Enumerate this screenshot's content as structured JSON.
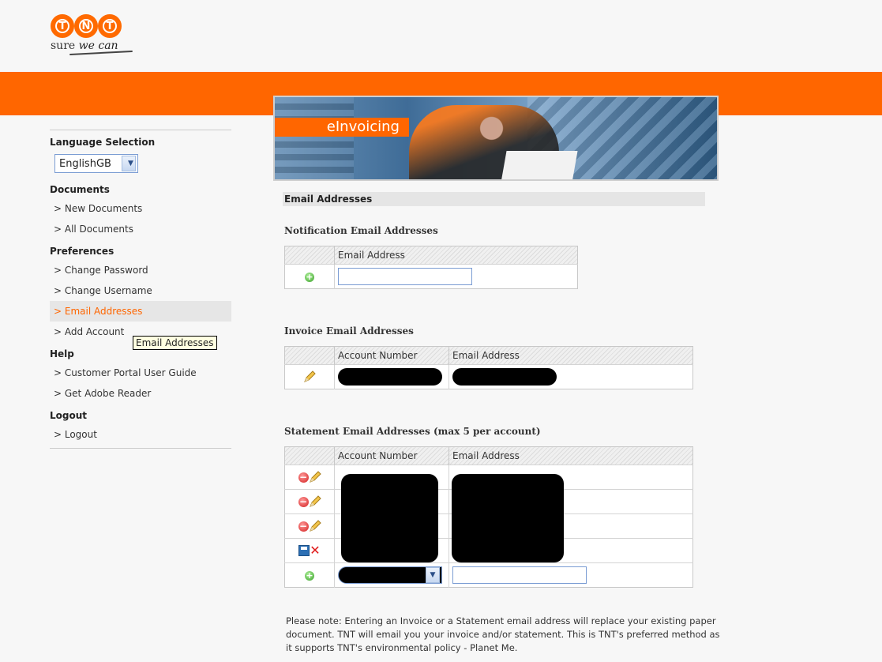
{
  "brand": {
    "logo_letters": [
      "T",
      "N",
      "T"
    ],
    "tagline_start": "sure ",
    "tagline_em": "we can",
    "brand_color": "#ff6600"
  },
  "banner": {
    "label": "eInvoicing"
  },
  "sidebar": {
    "language_label": "Language Selection",
    "language_value": "EnglishGB",
    "sections": {
      "documents": "Documents",
      "preferences": "Preferences",
      "help": "Help",
      "logout": "Logout"
    },
    "links": {
      "new_documents": "> New Documents",
      "all_documents": "> All Documents",
      "change_password": "> Change Password",
      "change_username": "> Change Username",
      "email_addresses": "> Email Addresses",
      "add_account": "> Add Account",
      "user_guide": "> Customer Portal User Guide",
      "adobe_reader": "> Get Adobe Reader",
      "logout": "> Logout"
    },
    "tooltip": "Email Addresses"
  },
  "content": {
    "section_title": "Email Addresses",
    "notification": {
      "title": "Notification Email Addresses",
      "col_email": "Email Address"
    },
    "invoice": {
      "title": "Invoice Email Addresses",
      "col_account": "Account Number",
      "col_email": "Email Address"
    },
    "statement": {
      "title": "Statement Email Addresses (max 5 per account)",
      "col_account": "Account Number",
      "col_email": "Email Address",
      "row_actions": [
        "remove-edit",
        "remove-edit",
        "remove-edit",
        "save-cancel",
        "add"
      ]
    },
    "note": "Please note: Entering an Invoice or a Statement email address will replace your existing paper document. TNT will email you your invoice and/or statement. This is TNT's preferred method as it supports TNT's environmental policy - Planet Me."
  }
}
